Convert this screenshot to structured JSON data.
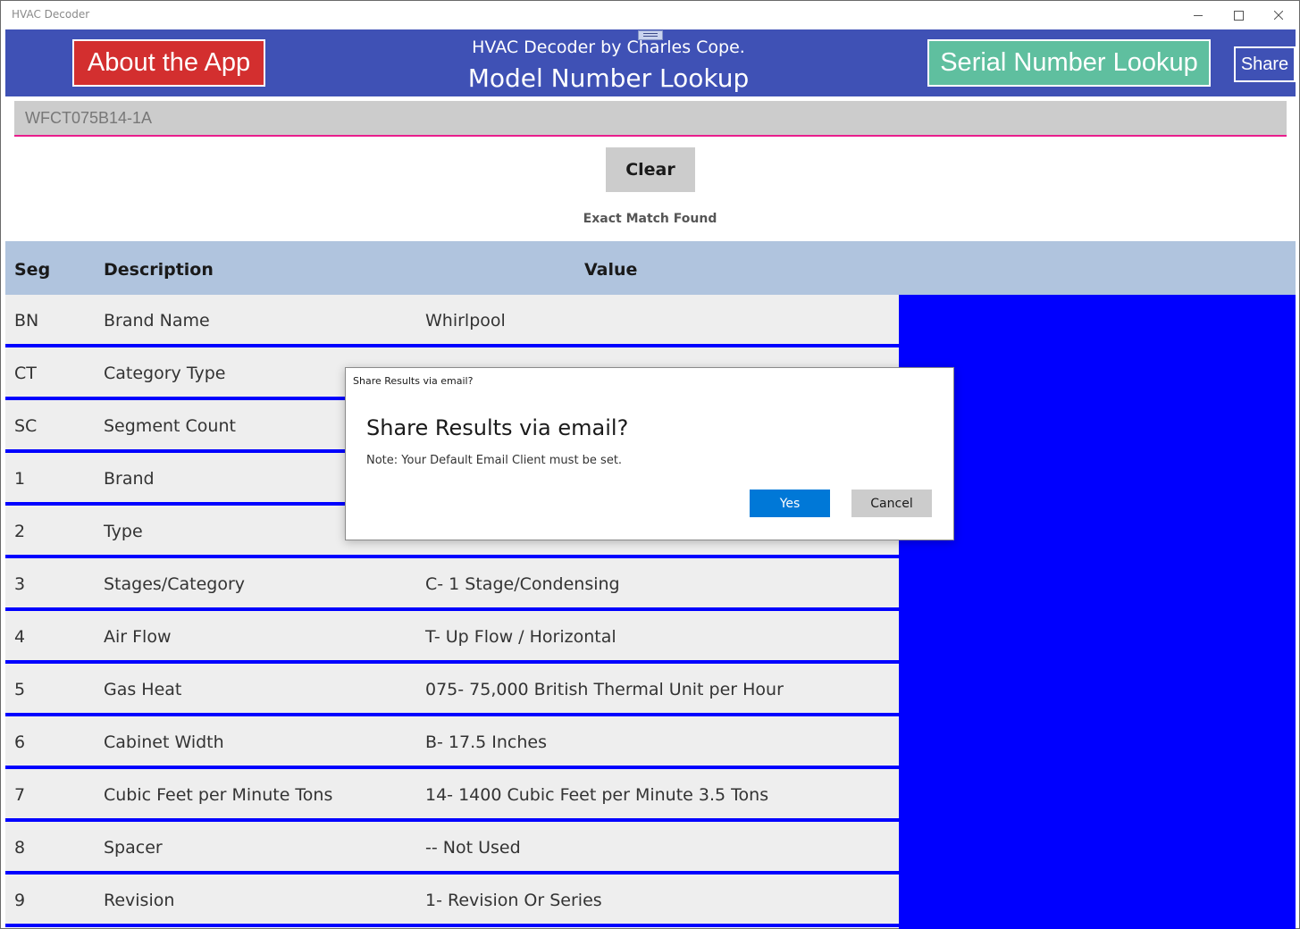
{
  "window": {
    "title": "HVAC Decoder",
    "controls": {
      "minimize": "minimize",
      "maximize": "maximize",
      "close": "close"
    }
  },
  "header": {
    "about_label": "About the App",
    "subtitle": "HVAC Decoder by Charles Cope.",
    "title": "Model Number Lookup",
    "serial_label": "Serial Number Lookup",
    "share_label": "Share",
    "colors": {
      "bar": "#3f51b5",
      "about": "#d32f2f",
      "serial": "#5fbf9f"
    }
  },
  "search": {
    "value": "WFCT075B14-1A"
  },
  "actions": {
    "clear_label": "Clear"
  },
  "status": "Exact Match Found",
  "table": {
    "headers": {
      "seg": "Seg",
      "description": "Description",
      "value": "Value"
    },
    "rows": [
      {
        "seg": "BN",
        "description": "Brand Name",
        "value": "Whirlpool"
      },
      {
        "seg": "CT",
        "description": "Category Type",
        "value": ""
      },
      {
        "seg": "SC",
        "description": "Segment Count",
        "value": ""
      },
      {
        "seg": "1",
        "description": "Brand",
        "value": ""
      },
      {
        "seg": "2",
        "description": "Type",
        "value": ""
      },
      {
        "seg": "3",
        "description": "Stages/Category",
        "value": "C- 1 Stage/Condensing"
      },
      {
        "seg": "4",
        "description": "Air Flow",
        "value": "T- Up Flow / Horizontal"
      },
      {
        "seg": "5",
        "description": "Gas Heat",
        "value": "075- 75,000 British Thermal Unit per Hour"
      },
      {
        "seg": "6",
        "description": "Cabinet Width",
        "value": "B- 17.5 Inches"
      },
      {
        "seg": "7",
        "description": "Cubic Feet per Minute Tons",
        "value": "14- 1400 Cubic Feet per Minute 3.5 Tons"
      },
      {
        "seg": "8",
        "description": "Spacer",
        "value": "-- Not Used"
      },
      {
        "seg": "9",
        "description": "Revision",
        "value": "1- Revision Or Series"
      }
    ]
  },
  "dialog": {
    "caption": "Share Results via email?",
    "title": "Share Results via email?",
    "note": "Note: Your Default Email Client must be set.",
    "yes_label": "Yes",
    "cancel_label": "Cancel"
  }
}
